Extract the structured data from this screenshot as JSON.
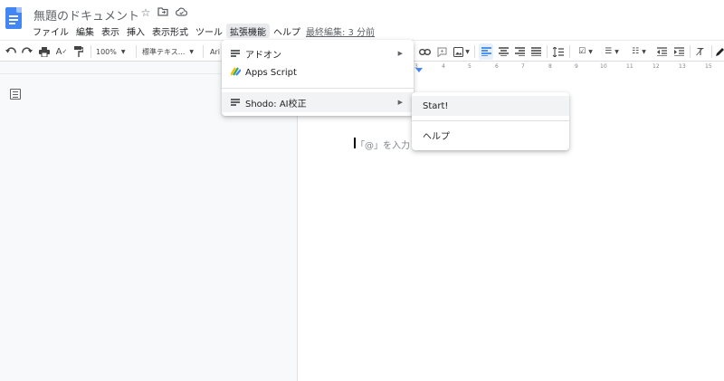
{
  "header": {
    "doc_title": "無題のドキュメント",
    "title_icons": [
      "star-icon",
      "move-to-folder-icon",
      "cloud-status-icon"
    ],
    "menus": [
      "ファイル",
      "編集",
      "表示",
      "挿入",
      "表示形式",
      "ツール",
      "拡張機能",
      "ヘルプ"
    ],
    "active_menu": "拡張機能",
    "last_edit": "最終編集: 3 分前"
  },
  "toolbar": {
    "zoom": "100%",
    "style": "標準テキス...",
    "font": "Ari"
  },
  "ruler": {
    "numbers": [
      "3",
      "4",
      "5",
      "6",
      "7",
      "8",
      "9",
      "10",
      "11",
      "12",
      "13",
      "14",
      "15"
    ]
  },
  "extensions_menu": {
    "items": [
      {
        "label": "アドオン",
        "icon": "add-ons-icon",
        "has_submenu": true
      },
      {
        "label": "Apps Script",
        "icon": "apps-script-icon",
        "has_submenu": false
      },
      {
        "label": "Shodo: AI校正",
        "icon": "shodo-icon",
        "has_submenu": true
      }
    ]
  },
  "submenu": {
    "items": [
      {
        "label": "Start!"
      },
      {
        "label": "ヘルプ"
      }
    ]
  },
  "document": {
    "placeholder": "「@」を入力し"
  },
  "colors": {
    "accent": "#1a73e8",
    "logo": "#4285f4",
    "menu_highlight": "#f1f3f4",
    "text": "#202124",
    "muted": "#5f6368"
  }
}
